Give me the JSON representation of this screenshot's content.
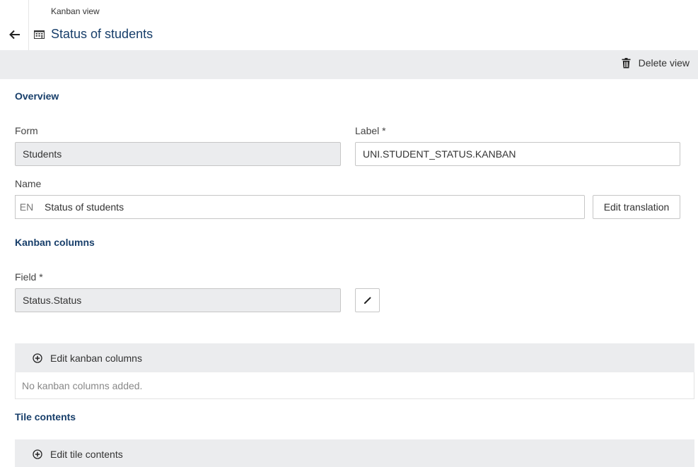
{
  "header": {
    "breadcrumb": "Kanban view",
    "title": "Status of students",
    "back_icon": "arrow-left-icon",
    "title_icon": "kanban-board-icon"
  },
  "toolbar": {
    "delete_label": "Delete view",
    "delete_icon": "trash-icon"
  },
  "overview": {
    "section_title": "Overview",
    "form": {
      "label": "Form",
      "value": "Students"
    },
    "label_field": {
      "label": "Label *",
      "value": "UNI.STUDENT_STATUS.KANBAN"
    },
    "name": {
      "label": "Name",
      "lang": "EN",
      "value": "Status of students"
    },
    "edit_translation_label": "Edit translation"
  },
  "kanban_columns": {
    "section_title": "Kanban columns",
    "field": {
      "label": "Field *",
      "value": "Status.Status"
    },
    "edit_icon": "pencil-icon",
    "edit_columns_label": "Edit kanban columns",
    "empty_text": "No kanban columns added."
  },
  "tile_contents": {
    "section_title": "Tile contents",
    "edit_label": "Edit tile contents"
  },
  "colors": {
    "accent": "#173e6a",
    "toolbar_bg": "#ebecee",
    "border": "#c6c6c6"
  }
}
